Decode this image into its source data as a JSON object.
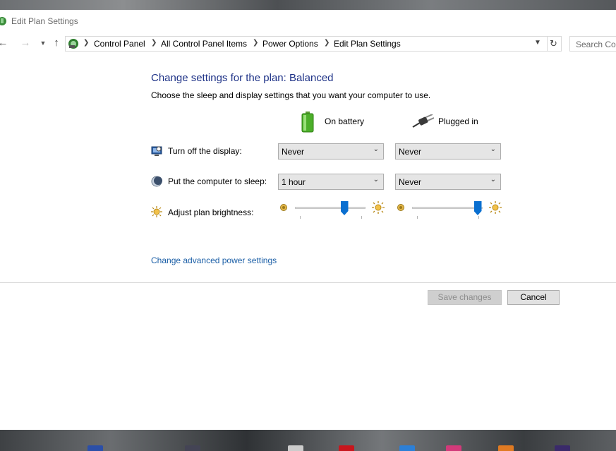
{
  "window": {
    "title": "Edit Plan Settings"
  },
  "address_bar": {
    "breadcrumbs": [
      "Control Panel",
      "All Control Panel Items",
      "Power Options",
      "Edit Plan Settings"
    ],
    "search_placeholder": "Search Cor"
  },
  "main": {
    "heading": "Change settings for the plan: Balanced",
    "subtitle": "Choose the sleep and display settings that you want your computer to use.",
    "columns": {
      "battery": "On battery",
      "plugged": "Plugged in"
    },
    "rows": {
      "display": {
        "label": "Turn off the display:",
        "battery_value": "Never",
        "plugged_value": "Never"
      },
      "sleep": {
        "label": "Put the computer to sleep:",
        "battery_value": "1 hour",
        "plugged_value": "Never"
      },
      "brightness": {
        "label": "Adjust plan brightness:",
        "battery_level": 0.7,
        "plugged_level": 0.93
      }
    },
    "advanced_link": "Change advanced power settings"
  },
  "footer": {
    "save_label": "Save changes",
    "cancel_label": "Cancel"
  },
  "colors": {
    "heading": "#1e3287",
    "link": "#1a5ea6",
    "slider_thumb": "#0a6fd0"
  }
}
